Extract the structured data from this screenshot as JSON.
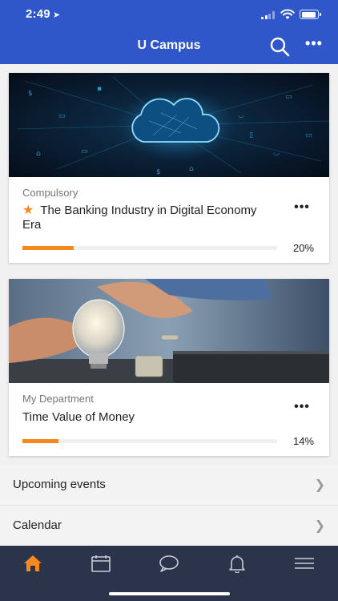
{
  "status_bar": {
    "time": "2:49",
    "location_arrow": "location-arrow-icon"
  },
  "header": {
    "title": "U Campus",
    "search_icon": "search-icon",
    "more_icon": "more-horizontal-icon"
  },
  "courses": [
    {
      "category": "Compulsory",
      "title": "The Banking Industry in Digital Economy Era",
      "starred": true,
      "progress": 0.2,
      "progress_label": "20%",
      "image": "digital-cloud-network-image"
    },
    {
      "category": "My Department",
      "title": "Time Value of Money",
      "starred": false,
      "progress": 0.14,
      "progress_label": "14%",
      "image": "lightbulb-coins-image"
    }
  ],
  "links": [
    {
      "label": "Upcoming events"
    },
    {
      "label": "Calendar"
    }
  ],
  "tabs": [
    {
      "icon": "home-icon",
      "active": true
    },
    {
      "icon": "calendar-icon",
      "active": false
    },
    {
      "icon": "chat-icon",
      "active": false
    },
    {
      "icon": "bell-icon",
      "active": false
    },
    {
      "icon": "menu-icon",
      "active": false
    }
  ],
  "colors": {
    "header": "#2f57c9",
    "accent": "#f5891f",
    "tabbar": "#2b344a",
    "tab_icon": "#c9cdd6"
  }
}
